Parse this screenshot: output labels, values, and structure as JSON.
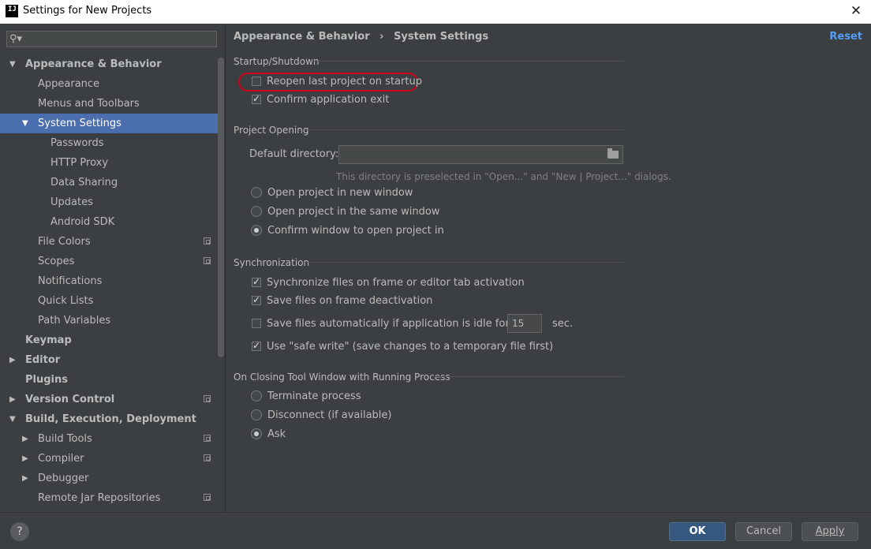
{
  "window": {
    "title": "Settings for New Projects"
  },
  "search": {
    "placeholder": ""
  },
  "sidebar": {
    "items": [
      {
        "label": "Appearance & Behavior",
        "level": 0,
        "expanded": true,
        "bold": true
      },
      {
        "label": "Appearance",
        "level": 1
      },
      {
        "label": "Menus and Toolbars",
        "level": 1
      },
      {
        "label": "System Settings",
        "level": 1,
        "expanded": true,
        "selected": true
      },
      {
        "label": "Passwords",
        "level": 2
      },
      {
        "label": "HTTP Proxy",
        "level": 2
      },
      {
        "label": "Data Sharing",
        "level": 2
      },
      {
        "label": "Updates",
        "level": 2
      },
      {
        "label": "Android SDK",
        "level": 2
      },
      {
        "label": "File Colors",
        "level": 1,
        "copy": true
      },
      {
        "label": "Scopes",
        "level": 1,
        "copy": true
      },
      {
        "label": "Notifications",
        "level": 1
      },
      {
        "label": "Quick Lists",
        "level": 1
      },
      {
        "label": "Path Variables",
        "level": 1
      },
      {
        "label": "Keymap",
        "level": 0,
        "bold": true
      },
      {
        "label": "Editor",
        "level": 0,
        "collapsed": true,
        "bold": true
      },
      {
        "label": "Plugins",
        "level": 0,
        "bold": true
      },
      {
        "label": "Version Control",
        "level": 0,
        "collapsed": true,
        "bold": true,
        "copy": true
      },
      {
        "label": "Build, Execution, Deployment",
        "level": 0,
        "expanded": true,
        "bold": true
      },
      {
        "label": "Build Tools",
        "level": 1,
        "collapsed": true,
        "copy": true
      },
      {
        "label": "Compiler",
        "level": 1,
        "collapsed": true,
        "copy": true
      },
      {
        "label": "Debugger",
        "level": 1,
        "collapsed": true
      },
      {
        "label": "Remote Jar Repositories",
        "level": 1,
        "copy": true
      }
    ]
  },
  "header": {
    "crumb_parent": "Appearance & Behavior",
    "crumb_sep": "›",
    "crumb_current": "System Settings",
    "reset": "Reset"
  },
  "startup": {
    "title": "Startup/Shutdown",
    "reopen": {
      "label": "Reopen last project on startup",
      "checked": false
    },
    "confirm_exit": {
      "label": "Confirm application exit",
      "checked": true
    }
  },
  "opening": {
    "title": "Project Opening",
    "dir_label": "Default directory:",
    "dir_value": "",
    "hint": "This directory is preselected in \"Open...\" and \"New | Project...\" dialogs.",
    "options": [
      {
        "label": "Open project in new window",
        "checked": false
      },
      {
        "label": "Open project in the same window",
        "checked": false
      },
      {
        "label": "Confirm window to open project in",
        "checked": true
      }
    ]
  },
  "sync": {
    "title": "Synchronization",
    "sync_files": {
      "label": "Synchronize files on frame or editor tab activation",
      "checked": true
    },
    "save_deactivation": {
      "label": "Save files on frame deactivation",
      "checked": true
    },
    "save_idle": {
      "label": "Save files automatically if application is idle for",
      "checked": false,
      "value": "15",
      "unit": "sec."
    },
    "safe_write": {
      "label": "Use \"safe write\" (save changes to a temporary file first)",
      "checked": true
    }
  },
  "closing": {
    "title": "On Closing Tool Window with Running Process",
    "options": [
      {
        "label": "Terminate process",
        "checked": false
      },
      {
        "label": "Disconnect (if available)",
        "checked": false
      },
      {
        "label": "Ask",
        "checked": true
      }
    ]
  },
  "footer": {
    "help": "?",
    "ok": "OK",
    "cancel": "Cancel",
    "apply": "Apply"
  },
  "colors": {
    "accent": "#4b6eaf",
    "link": "#589df6",
    "highlight": "#d0021b",
    "background": "#3c3f41"
  }
}
